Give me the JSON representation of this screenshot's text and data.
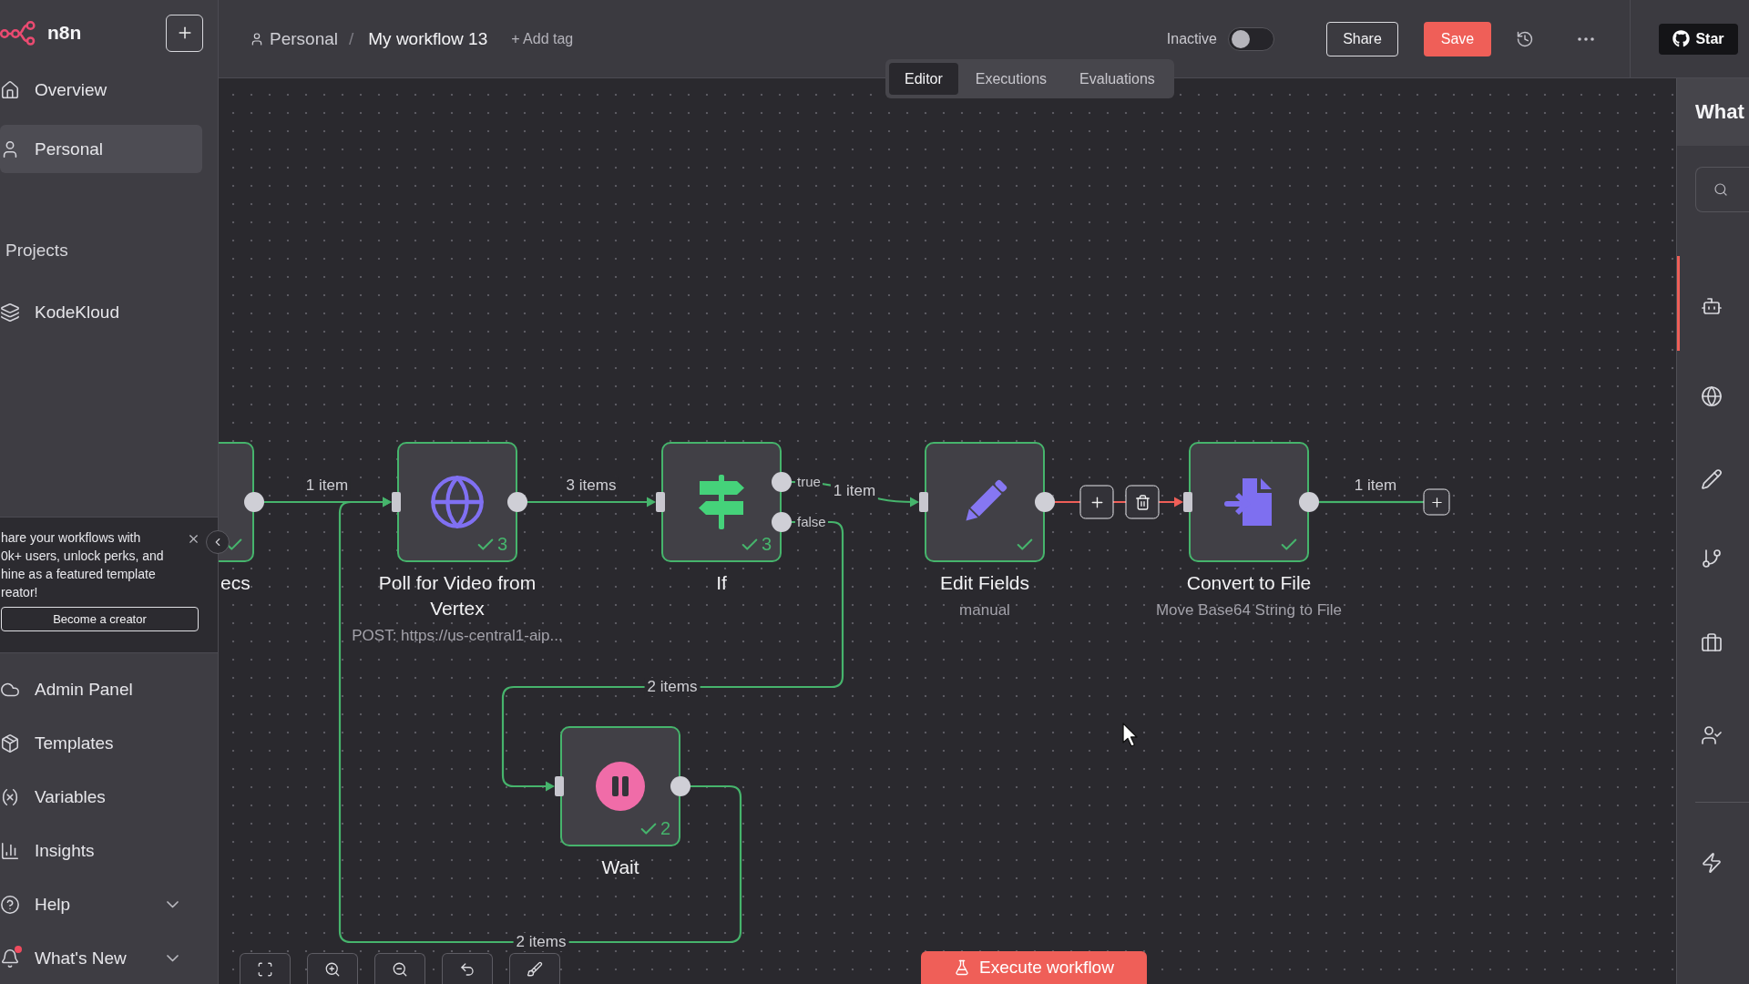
{
  "sidebar": {
    "logo_text": "n8n",
    "nav_top": [
      {
        "label": "Overview",
        "selected": false
      },
      {
        "label": "Personal",
        "selected": true
      }
    ],
    "projects_heading": "Projects",
    "projects": [
      {
        "label": "KodeKloud",
        "selected": false
      }
    ],
    "promo": {
      "text": "hare your workflows with\n0k+ users, unlock perks, and\nhine as a featured template\nreator!",
      "button": "Become a creator"
    },
    "nav_bottom": [
      {
        "label": "Admin Panel",
        "expandable": false,
        "notification": false
      },
      {
        "label": "Templates",
        "expandable": false,
        "notification": false
      },
      {
        "label": "Variables",
        "expandable": false,
        "notification": false
      },
      {
        "label": "Insights",
        "expandable": false,
        "notification": false
      },
      {
        "label": "Help",
        "expandable": true,
        "notification": false
      },
      {
        "label": "What's New",
        "expandable": true,
        "notification": true
      }
    ]
  },
  "header": {
    "project": "Personal",
    "separator": "/",
    "workflow_name": "My workflow 13",
    "add_tag": "+ Add tag",
    "status": {
      "label": "Inactive",
      "active": false
    },
    "share": "Share",
    "save": "Save",
    "github": "Star"
  },
  "tabs": [
    {
      "label": "Editor",
      "selected": true
    },
    {
      "label": "Executions",
      "selected": false
    },
    {
      "label": "Evaluations",
      "selected": false
    }
  ],
  "canvas": {
    "nodes": [
      {
        "kind": "partial",
        "title": "ecs",
        "executed": true
      },
      {
        "kind": "http",
        "title": "Poll for Video from Vertex",
        "subtitle": "POST: https://us-central1-aip...",
        "executed": true,
        "run_count": "3"
      },
      {
        "kind": "if",
        "title": "If",
        "executed": true,
        "run_count": "3",
        "outputs": [
          "true",
          "false"
        ]
      },
      {
        "kind": "set",
        "title": "Edit Fields",
        "subtitle": "manual",
        "executed": true
      },
      {
        "kind": "convert",
        "title": "Convert to File",
        "subtitle": "Move Base64 String to File",
        "executed": true
      },
      {
        "kind": "wait",
        "title": "Wait",
        "executed": true,
        "run_count": "2"
      }
    ],
    "connections": [
      {
        "label": "1 item",
        "hovered": false
      },
      {
        "label": "3 items",
        "hovered": false
      },
      {
        "label": "1 item",
        "hovered": false
      },
      {
        "hovered": true
      },
      {
        "label": "2 items",
        "hovered": false
      },
      {
        "label": "2 items",
        "hovered": false
      }
    ],
    "end_connector": {
      "label": "1 item"
    },
    "execute_button": "Execute workflow"
  },
  "side_panel": {
    "title": "What"
  }
}
